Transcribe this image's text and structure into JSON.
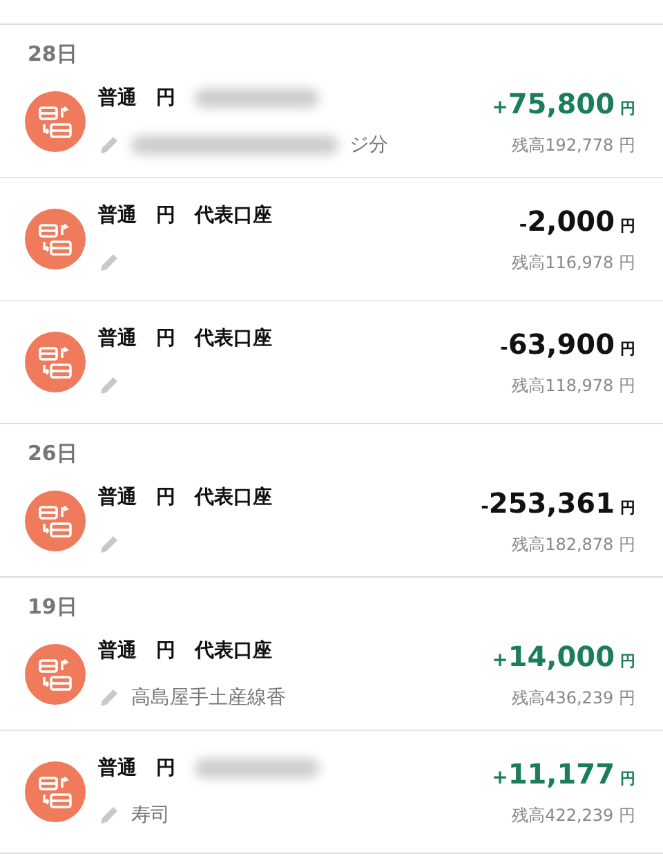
{
  "sections": [
    {
      "date": "28日",
      "transactions": [
        {
          "account": "普通　円",
          "name_blurred": true,
          "memo": "ジ分",
          "memo_blurred": true,
          "credit": true,
          "sign": "+",
          "amount": "75,800",
          "unit": "円",
          "balance": "残高192,778 円"
        },
        {
          "account": "普通　円",
          "name": "代表口座",
          "credit": false,
          "sign": "-",
          "amount": "2,000",
          "unit": "円",
          "balance": "残高116,978 円"
        },
        {
          "account": "普通　円",
          "name": "代表口座",
          "credit": false,
          "sign": "-",
          "amount": "63,900",
          "unit": "円",
          "balance": "残高118,978 円"
        }
      ]
    },
    {
      "date": "26日",
      "transactions": [
        {
          "account": "普通　円",
          "name": "代表口座",
          "credit": false,
          "sign": "-",
          "amount": "253,361",
          "unit": "円",
          "balance": "残高182,878 円"
        }
      ]
    },
    {
      "date": "19日",
      "transactions": [
        {
          "account": "普通　円",
          "name": "代表口座",
          "memo": "高島屋手土産線香",
          "credit": true,
          "sign": "+",
          "amount": "14,000",
          "unit": "円",
          "balance": "残高436,239 円"
        },
        {
          "account": "普通　円",
          "name_blurred": true,
          "memo": "寿司",
          "credit": true,
          "sign": "+",
          "amount": "11,177",
          "unit": "円",
          "balance": "残高422,239 円"
        }
      ]
    }
  ]
}
